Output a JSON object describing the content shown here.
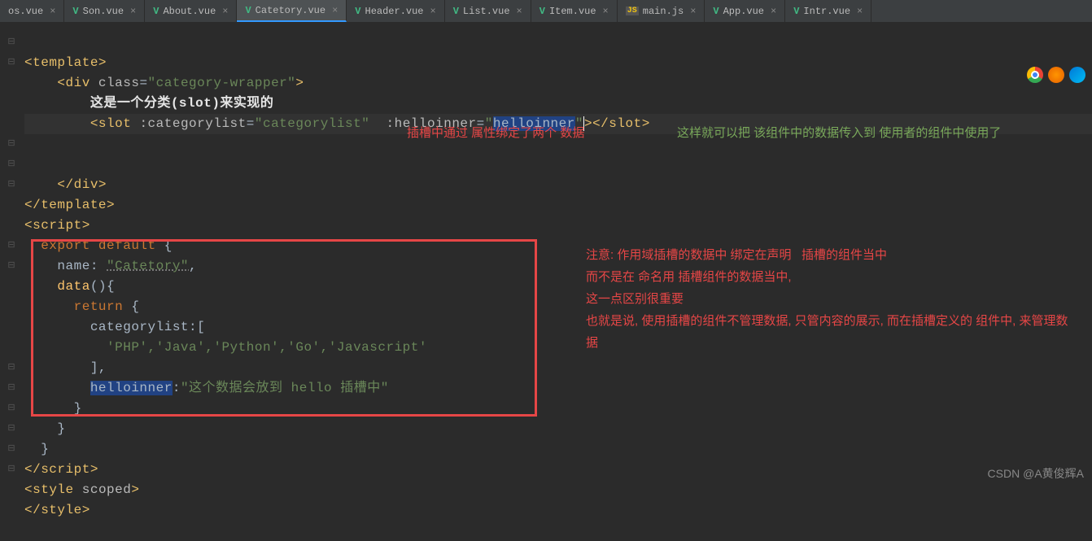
{
  "tabs": [
    {
      "label": "os.vue",
      "icon": "V",
      "type": "vue"
    },
    {
      "label": "Son.vue",
      "icon": "V",
      "type": "vue"
    },
    {
      "label": "About.vue",
      "icon": "V",
      "type": "vue"
    },
    {
      "label": "Catetory.vue",
      "icon": "V",
      "type": "vue",
      "active": true
    },
    {
      "label": "Header.vue",
      "icon": "V",
      "type": "vue"
    },
    {
      "label": "List.vue",
      "icon": "V",
      "type": "vue"
    },
    {
      "label": "Item.vue",
      "icon": "V",
      "type": "vue"
    },
    {
      "label": "main.js",
      "icon": "JS",
      "type": "js"
    },
    {
      "label": "App.vue",
      "icon": "V",
      "type": "vue"
    },
    {
      "label": "Intr.vue",
      "icon": "V",
      "type": "vue"
    }
  ],
  "code": {
    "l1_tag": "template",
    "l2_open": "<div ",
    "l2_attr": "class",
    "l2_val": "\"category-wrapper\"",
    "l3_text": "这是一个分类(slot)来实现的",
    "l4_slot": "slot",
    "l4_a1": ":categorylist",
    "l4_v1": "\"categorylist\"",
    "l4_a2": ":helloinner",
    "l4_v2_pre": "\"",
    "l4_v2_sel": "helloinner",
    "l4_v2_post": "\"",
    "l6_close": "div",
    "l7_close": "template",
    "l8_open": "script",
    "l9_export": "export default",
    "l10_name_k": "name",
    "l10_name_v": "\"Catetory\"",
    "l11_data": "data",
    "l12_return": "return",
    "l13_key": "categorylist",
    "l14_arr": "'PHP','Java','Python','Go','Javascript'",
    "l16_key": "helloinner",
    "l16_val": "\"这个数据会放到 hello 插槽中\"",
    "l20_close": "script",
    "l21_style": "style",
    "l21_scoped": "scoped"
  },
  "annotations": {
    "red1": "插槽中通过 属性绑定了两个 数据",
    "green1": "这样就可以把 该组件中的数据传入到 使用者的组件中使用了",
    "red2": "注意: 作用域插槽的数据中 绑定在声明   插槽的组件当中\n而不是在 命名用 插槽组件的数据当中,\n这一点区别很重要\n也就是说, 使用插槽的组件不管理数据, 只管内容的展示, 而在插槽定义的 组件中, 来管理数据"
  },
  "watermark": "CSDN @A黄俊辉A"
}
